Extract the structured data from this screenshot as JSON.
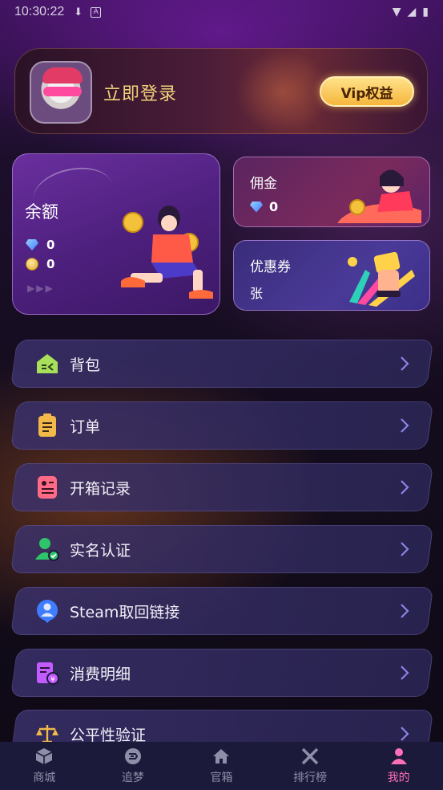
{
  "status_bar": {
    "time": "10:30:22"
  },
  "header": {
    "login_text": "立即登录",
    "vip_button": "Vip权益"
  },
  "balance": {
    "title": "余额",
    "diamond_value": "0",
    "coin_value": "0"
  },
  "commission": {
    "title": "佣金",
    "value": "0"
  },
  "coupon": {
    "title": "优惠券",
    "unit": "张"
  },
  "menu": [
    {
      "label": "背包",
      "icon": "backpack-icon",
      "color": "#a8e05a"
    },
    {
      "label": "订单",
      "icon": "order-clipboard-icon",
      "color": "#f2b84a"
    },
    {
      "label": "开箱记录",
      "icon": "record-icon",
      "color": "#ff6a86"
    },
    {
      "label": "实名认证",
      "icon": "verified-user-icon",
      "color": "#2fc46a"
    },
    {
      "label": "Steam取回链接",
      "icon": "steam-link-icon",
      "color": "#3f7dff"
    },
    {
      "label": "消费明细",
      "icon": "consumption-icon",
      "color": "#c35cff"
    },
    {
      "label": "公平性验证",
      "icon": "scale-icon",
      "color": "#f2b84a"
    }
  ],
  "tabs": [
    {
      "label": "商城",
      "icon": "shop-cube-icon"
    },
    {
      "label": "追梦",
      "icon": "dream-icon"
    },
    {
      "label": "官箱",
      "icon": "home-icon"
    },
    {
      "label": "排行榜",
      "icon": "ranking-icon"
    },
    {
      "label": "我的",
      "icon": "profile-icon",
      "active": true
    }
  ]
}
